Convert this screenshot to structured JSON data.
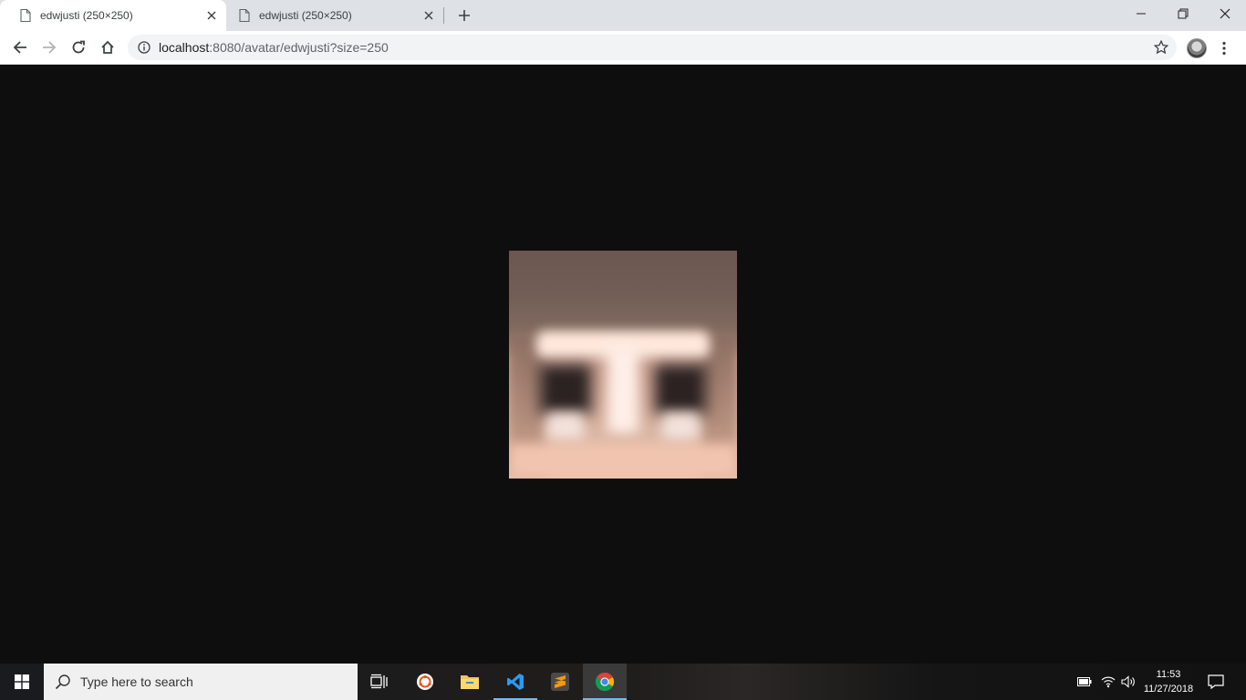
{
  "browser": {
    "tabs": [
      {
        "title": "edwjusti (250×250)",
        "active": true
      },
      {
        "title": "edwjusti (250×250)",
        "active": false
      }
    ],
    "address": {
      "host": "localhost",
      "rest": ":8080/avatar/edwjusti?size=250"
    }
  },
  "page": {
    "image_alt": "edwjusti avatar"
  },
  "taskbar": {
    "search_placeholder": "Type here to search",
    "time": "11:53",
    "date": "11/27/2018"
  },
  "colors": {
    "tabstrip": "#dee1e6",
    "viewport_bg": "#0e0e0e",
    "taskbar_search": "#f0f0f0",
    "running_indicator": "#76b9ed"
  }
}
